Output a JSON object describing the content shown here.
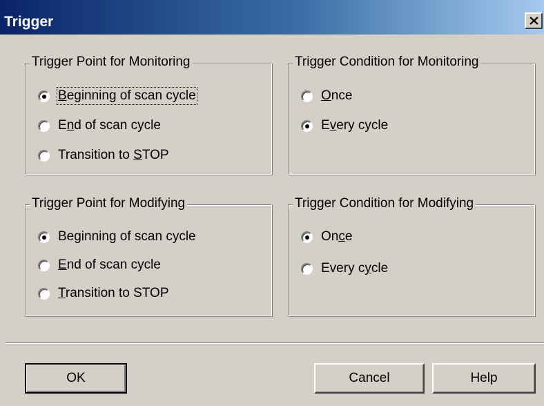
{
  "window": {
    "title": "Trigger",
    "close_glyph": "×"
  },
  "groups": {
    "point_monitoring": {
      "title": "Trigger Point for Monitoring",
      "options": [
        {
          "pre": "",
          "u": "B",
          "post": "eginning of scan cycle",
          "checked": true,
          "focused": true
        },
        {
          "pre": "E",
          "u": "n",
          "post": "d of scan cycle",
          "checked": false
        },
        {
          "pre": "Transition to ",
          "u": "S",
          "post": "TOP",
          "checked": false
        }
      ]
    },
    "condition_monitoring": {
      "title": "Trigger Condition for Monitoring",
      "options": [
        {
          "pre": "",
          "u": "O",
          "post": "nce",
          "checked": false
        },
        {
          "pre": "E",
          "u": "v",
          "post": "ery cycle",
          "checked": true
        }
      ]
    },
    "point_modifying": {
      "title": "Trigger Point for Modifying",
      "options": [
        {
          "pre": "Beginning of scan cycle",
          "u": "",
          "post": "",
          "checked": true
        },
        {
          "pre": "",
          "u": "E",
          "post": "nd of scan cycle",
          "checked": false
        },
        {
          "pre": "",
          "u": "T",
          "post": "ransition to STOP",
          "checked": false
        }
      ]
    },
    "condition_modifying": {
      "title": "Trigger Condition for Modifying",
      "options": [
        {
          "pre": "On",
          "u": "c",
          "post": "e",
          "checked": true
        },
        {
          "pre": "Every c",
          "u": "y",
          "post": "cle",
          "checked": false
        }
      ]
    }
  },
  "buttons": {
    "ok": "OK",
    "cancel": "Cancel",
    "help": "Help"
  }
}
